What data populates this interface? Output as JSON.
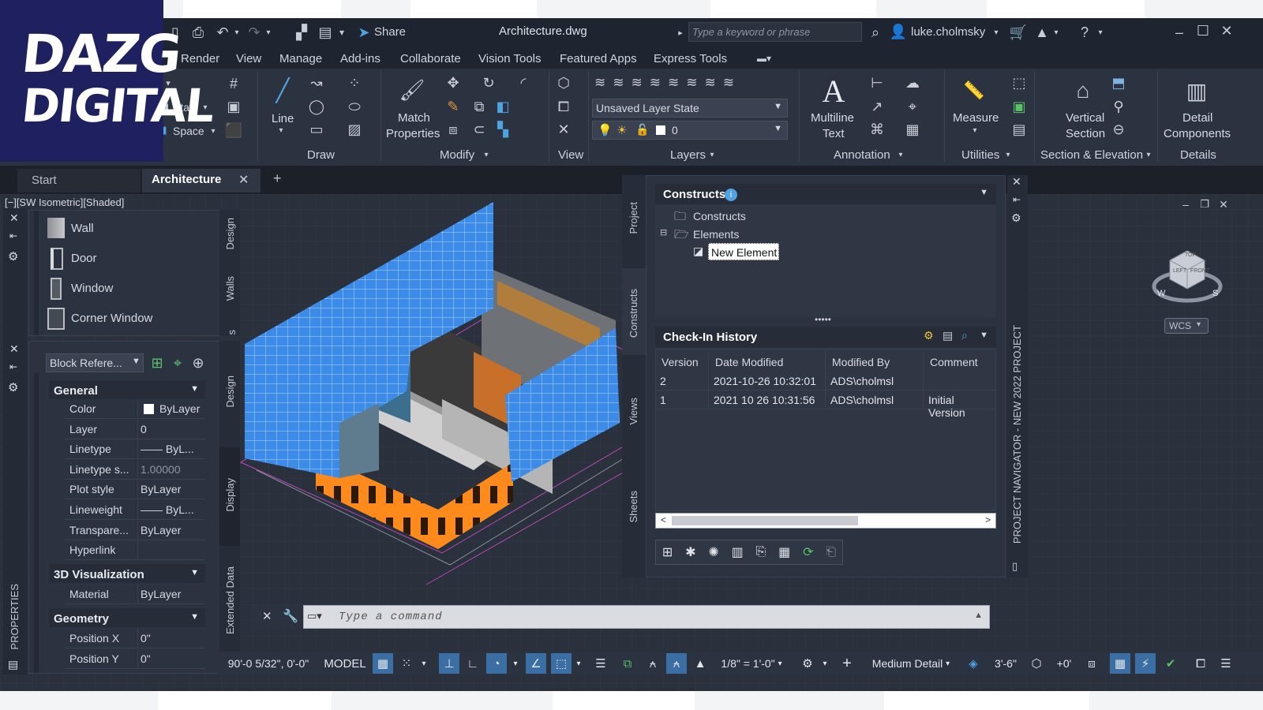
{
  "logo": {
    "line1": "DAZG",
    "line2": "DIGITAL"
  },
  "titlebar": {
    "share": "Share",
    "doc_title": "Architecture.dwg",
    "search_placeholder": "Type a keyword or phrase",
    "user": "luke.cholmsky"
  },
  "menu": [
    "Render",
    "View",
    "Manage",
    "Add-ins",
    "Collaborate",
    "Vision Tools",
    "Featured Apps",
    "Express Tools"
  ],
  "ribbon": {
    "build": {
      "stair": "Stair",
      "space": "Space"
    },
    "draw": {
      "line": "Line",
      "label": "Draw"
    },
    "modify": {
      "match": "Match",
      "properties": "Properties",
      "label": "Modify"
    },
    "view": {
      "label": "View"
    },
    "layers": {
      "layer_state": "Unsaved Layer State",
      "layer_value": "0",
      "label": "Layers"
    },
    "annotation": {
      "mtext1": "Multiline",
      "mtext2": "Text",
      "label": "Annotation"
    },
    "utilities": {
      "measure": "Measure",
      "label": "Utilities"
    },
    "section": {
      "l1": "Vertical",
      "l2": "Section",
      "label": "Section & Elevation"
    },
    "details": {
      "l1": "Detail",
      "l2": "Components",
      "label": "Details"
    }
  },
  "tabs": {
    "start": "Start",
    "active": "Architecture",
    "add": "+"
  },
  "viewport_label": "[−][SW Isometric][Shaded]",
  "tool_palette": {
    "items": [
      "Wall",
      "Door",
      "Window",
      "Corner Window"
    ],
    "tabs": [
      "Design",
      "Walls",
      "s",
      "Design",
      "Display",
      "Extended Data"
    ]
  },
  "properties": {
    "selector": "Block Refere...",
    "palette_label": "PROPERTIES",
    "general_title": "General",
    "general": [
      {
        "k": "Color",
        "v": "ByLayer"
      },
      {
        "k": "Layer",
        "v": "0"
      },
      {
        "k": "Linetype",
        "v": "—— ByL..."
      },
      {
        "k": "Linetype s...",
        "v": "1.00000"
      },
      {
        "k": "Plot style",
        "v": "ByLayer"
      },
      {
        "k": "Lineweight",
        "v": "—— ByL..."
      },
      {
        "k": "Transpare...",
        "v": "ByLayer"
      },
      {
        "k": "Hyperlink",
        "v": ""
      }
    ],
    "viz_title": "3D Visualization",
    "viz": [
      {
        "k": "Material",
        "v": "ByLayer"
      }
    ],
    "geom_title": "Geometry",
    "geom": [
      {
        "k": "Position X",
        "v": "0\""
      },
      {
        "k": "Position Y",
        "v": "0\""
      }
    ]
  },
  "navigator": {
    "side_tabs": [
      "Project",
      "Constructs",
      "Views",
      "Sheets"
    ],
    "constructs_title": "Constructs",
    "tree": [
      "Constructs",
      "Elements",
      "New Element"
    ],
    "history_title": "Check-In History",
    "columns": [
      "Version",
      "Date Modified",
      "Modified By",
      "Comment"
    ],
    "rows": [
      {
        "version": "2",
        "date": "2021-10-26 10:32:01",
        "by": "ADS\\cholmsl",
        "comment": ""
      },
      {
        "version": "1",
        "date": "2021 10 26 10:31:56",
        "by": "ADS\\cholmsl",
        "comment": "Initial Version"
      }
    ],
    "vertical_title": "PROJECT NAVIGATOR - NEW 2022 PROJECT"
  },
  "viewcube": {
    "wcs": "WCS",
    "top": "TOP",
    "left": "LEFT",
    "front": "FRONT",
    "w": "W",
    "s": "S"
  },
  "command": {
    "placeholder": "Type a command"
  },
  "statusbar": {
    "coords": "90'-0 5/32\", 0'-0\"",
    "model": "MODEL",
    "scale": "1/8\" = 1'-0\"",
    "detail": "Medium Detail",
    "elevation": "3'-6\"",
    "offset": "+0'"
  }
}
